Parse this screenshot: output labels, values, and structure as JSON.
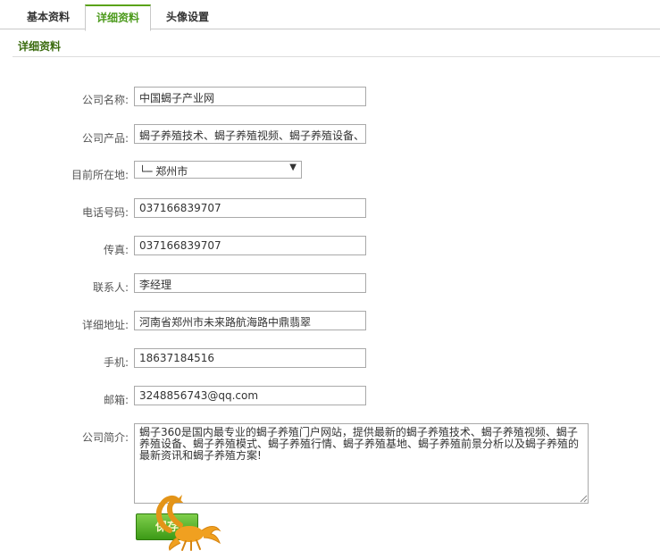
{
  "tabs": [
    {
      "label": "基本资料",
      "active": false
    },
    {
      "label": "详细资料",
      "active": true
    },
    {
      "label": "头像设置",
      "active": false
    }
  ],
  "section": {
    "title": "详细资料"
  },
  "form": {
    "company_name": {
      "label": "公司名称:",
      "value": "中国蝎子产业网"
    },
    "company_products": {
      "label": "公司产品:",
      "value": "蝎子养殖技术、蝎子养殖视频、蝎子养殖设备、"
    },
    "location": {
      "label": "目前所在地:",
      "value": "└─ 郑州市"
    },
    "phone": {
      "label": "电话号码:",
      "value": "037166839707"
    },
    "fax": {
      "label": "传真:",
      "value": "037166839707"
    },
    "contact": {
      "label": "联系人:",
      "value": "李经理"
    },
    "address": {
      "label": "详细地址:",
      "value": "河南省郑州市未来路航海路中鼎翡翠"
    },
    "mobile": {
      "label": "手机:",
      "value": "18637184516"
    },
    "email": {
      "label": "邮箱:",
      "value": "3248856743@qq.com"
    },
    "intro": {
      "label": "公司简介:",
      "value": "蝎子360是国内最专业的蝎子养殖门户网站，提供最新的蝎子养殖技术、蝎子养殖视频、蝎子养殖设备、蝎子养殖模式、蝎子养殖行情、蝎子养殖基地、蝎子养殖前景分析以及蝎子养殖的最新资讯和蝎子养殖方案!"
    }
  },
  "submit": {
    "label": "保存"
  },
  "colors": {
    "accent": "#5aa317",
    "section_title": "#3b6b0f",
    "button_top": "#7fcf4c",
    "button_bottom": "#3c9a16"
  }
}
